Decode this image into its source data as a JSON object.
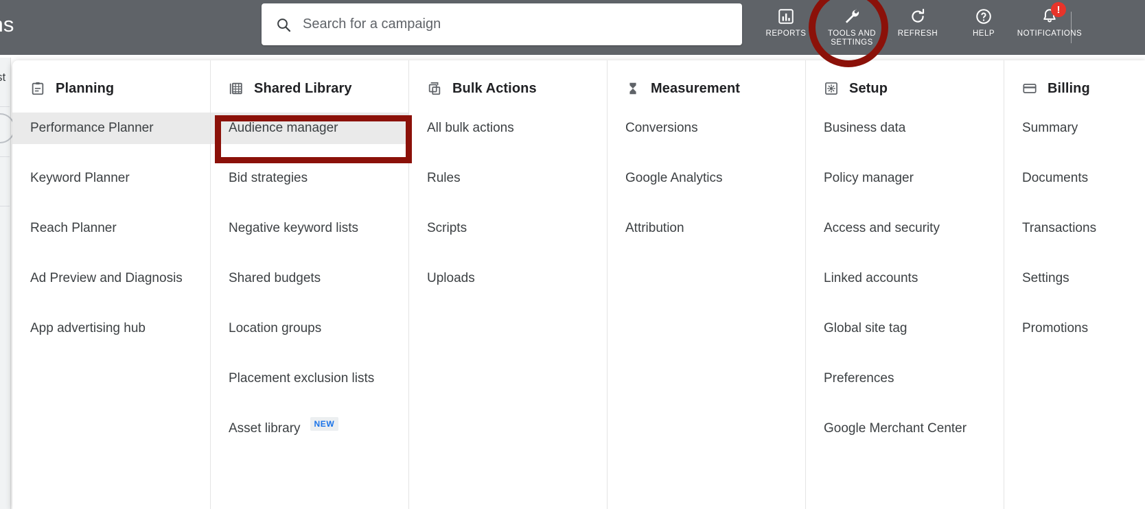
{
  "topbar": {
    "page_title_clipped": "gns",
    "bg_color": "#5f6368",
    "search": {
      "placeholder": "Search for a campaign",
      "value": "",
      "icon": "search-icon"
    },
    "tools": [
      {
        "label": "REPORTS",
        "icon": "bar-chart-icon"
      },
      {
        "label": "TOOLS AND SETTINGS",
        "icon": "wrench-icon"
      },
      {
        "label": "REFRESH",
        "icon": "refresh-icon"
      },
      {
        "label": "HELP",
        "icon": "help-circle-icon"
      },
      {
        "label": "NOTIFICATIONS",
        "icon": "bell-icon",
        "badge": "!",
        "badge_color": "#e8342a"
      }
    ]
  },
  "background": {
    "left_text_clipped": "st"
  },
  "annotations": {
    "color": "#8b1109",
    "circle_target": "TOOLS AND SETTINGS",
    "box_target": "Audience manager"
  },
  "menu": {
    "columns": [
      {
        "title": "Planning",
        "icon": "clipboard-icon",
        "items": [
          {
            "label": "Performance Planner",
            "selected": true
          },
          {
            "label": "Keyword Planner",
            "selected": false
          },
          {
            "label": "Reach Planner",
            "selected": false
          },
          {
            "label": "Ad Preview and Diagnosis",
            "selected": false
          },
          {
            "label": "App advertising hub",
            "selected": false
          }
        ]
      },
      {
        "title": "Shared Library",
        "icon": "library-grid-icon",
        "items": [
          {
            "label": "Audience manager",
            "selected": true,
            "highlighted": true
          },
          {
            "label": "Bid strategies",
            "selected": false
          },
          {
            "label": "Negative keyword lists",
            "selected": false
          },
          {
            "label": "Shared budgets",
            "selected": false
          },
          {
            "label": "Location groups",
            "selected": false
          },
          {
            "label": "Placement exclusion lists",
            "selected": false
          },
          {
            "label": "Asset library",
            "selected": false,
            "badge": "NEW"
          }
        ]
      },
      {
        "title": "Bulk Actions",
        "icon": "copy-stack-icon",
        "items": [
          {
            "label": "All bulk actions",
            "selected": false
          },
          {
            "label": "Rules",
            "selected": false
          },
          {
            "label": "Scripts",
            "selected": false
          },
          {
            "label": "Uploads",
            "selected": false
          }
        ]
      },
      {
        "title": "Measurement",
        "icon": "hourglass-icon",
        "items": [
          {
            "label": "Conversions",
            "selected": false
          },
          {
            "label": "Google Analytics",
            "selected": false
          },
          {
            "label": "Attribution",
            "selected": false
          }
        ]
      },
      {
        "title": "Setup",
        "icon": "gear-square-icon",
        "items": [
          {
            "label": "Business data",
            "selected": false
          },
          {
            "label": "Policy manager",
            "selected": false
          },
          {
            "label": "Access and security",
            "selected": false
          },
          {
            "label": "Linked accounts",
            "selected": false
          },
          {
            "label": "Global site tag",
            "selected": false
          },
          {
            "label": "Preferences",
            "selected": false
          },
          {
            "label": "Google Merchant Center",
            "selected": false
          }
        ]
      },
      {
        "title": "Billing",
        "icon": "credit-card-icon",
        "clipped": true,
        "items": [
          {
            "label": "Summary",
            "selected": false
          },
          {
            "label": "Documents",
            "selected": false
          },
          {
            "label": "Transactions",
            "selected": false
          },
          {
            "label": "Settings",
            "selected": false
          },
          {
            "label": "Promotions",
            "selected": false
          }
        ]
      }
    ]
  }
}
